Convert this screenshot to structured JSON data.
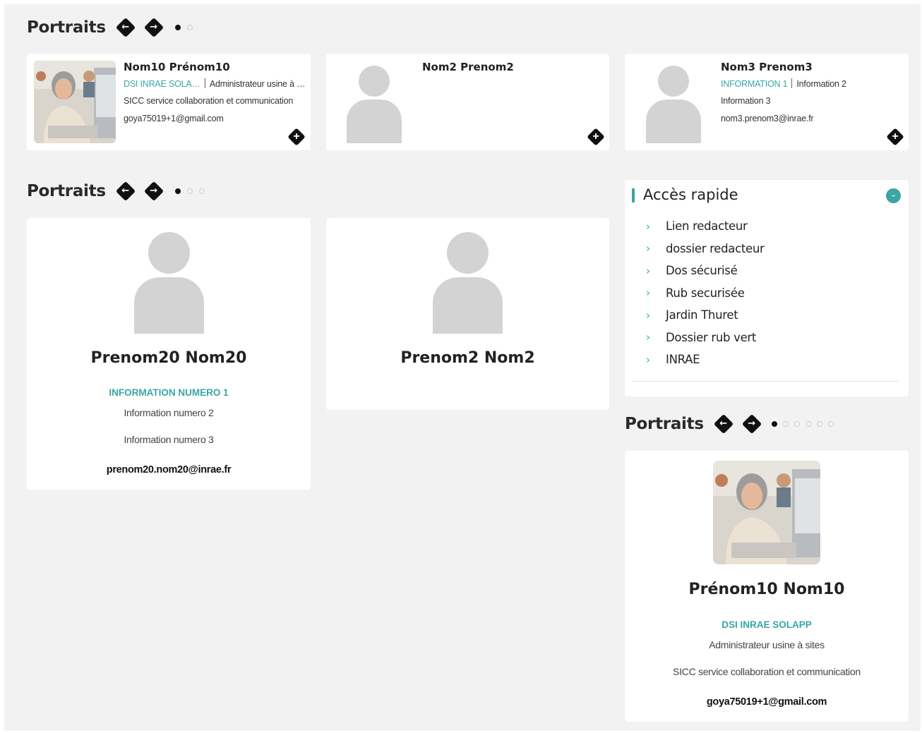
{
  "section1": {
    "title": "Portraits",
    "prev_arrow": "🡠",
    "next_arrow": "🡢",
    "cards": [
      {
        "name": "Nom10 Prénom10",
        "line1_teal": "DSI INRAE SOLA…",
        "line1_rest": "Administrateur usine à …",
        "line2": "SICC service collaboration et communication",
        "line3": "goya75019+1@gmail.com"
      },
      {
        "name": "Nom2 Prenom2"
      },
      {
        "name": "Nom3 Prenom3",
        "line1_teal": "INFORMATION 1",
        "line1_rest": "Information 2",
        "line2": "Information 3",
        "line3": "nom3.prenom3@inrae.fr"
      }
    ]
  },
  "section2": {
    "title": "Portraits",
    "cards": [
      {
        "name": "Prenom20 Nom20",
        "info1": "INFORMATION NUMERO 1",
        "info2": "Information numero 2",
        "info3": "Information numero 3",
        "email": "prenom20.nom20@inrae.fr"
      },
      {
        "name": "Prenom2 Nom2"
      }
    ]
  },
  "acces_rapide": {
    "title": "Accès rapide",
    "items": [
      "Lien redacteur",
      "dossier redacteur",
      "Dos sécurisé",
      "Rub securisée",
      "Jardin Thuret",
      "Dossier rub vert",
      "INRAE"
    ]
  },
  "section3": {
    "title": "Portraits",
    "card": {
      "name": "Prénom10 Nom10",
      "info1": "DSI INRAE SOLAPP",
      "info2": "Administrateur usine à sites",
      "info3": "SICC service collaboration et communication",
      "email": "goya75019+1@gmail.com"
    }
  },
  "colors": {
    "accent": "#3aa5a5",
    "page_bg": "#f2f2f2",
    "placeholder": "#d3d3d3"
  },
  "icons": {
    "plus": "+",
    "chevron": "›",
    "toggle": "⌄"
  }
}
